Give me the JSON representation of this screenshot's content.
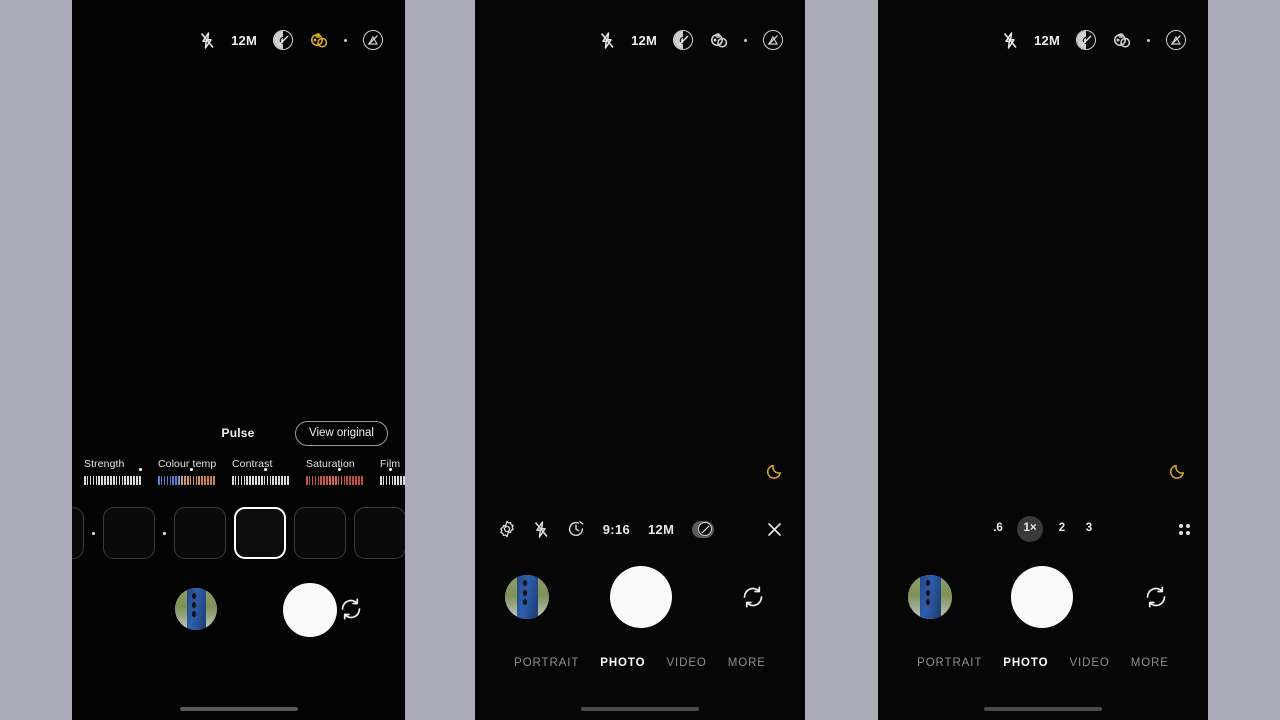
{
  "background_color": "#ACACB8",
  "panels": [
    {
      "id": "edit-panel",
      "name": "photo-filter-editor",
      "topbar": {
        "flash_icon": "flash-off-icon",
        "resolution": "12M",
        "motion_photo_icon": "motion-photo-off-icon",
        "ai_icon": "ai-scene-optimizer-icon",
        "separator": "dot-separator",
        "effects_icon": "camera-effects-icon"
      },
      "filter_name": "Pulse",
      "view_original_label": "View original",
      "adjustments": [
        {
          "label": "Strength",
          "style": "plain",
          "marker_pct": 88
        },
        {
          "label": "Colour temp",
          "style": "temp",
          "marker_pct": 50
        },
        {
          "label": "Contrast",
          "style": "plain",
          "marker_pct": 50
        },
        {
          "label": "Saturation",
          "style": "sat",
          "marker_pct": 50
        },
        {
          "label": "Film",
          "style": "plain",
          "marker_pct": 50
        }
      ],
      "filter_thumbnails": [
        {
          "name": "filter-thumb-partial",
          "selected": false
        },
        {
          "name": "filter-thumb-1",
          "selected": false
        },
        {
          "name": "filter-thumb-2",
          "selected": false
        },
        {
          "name": "filter-thumb-pulse",
          "selected": true
        },
        {
          "name": "filter-thumb-4",
          "selected": false
        },
        {
          "name": "filter-thumb-5",
          "selected": false
        },
        {
          "name": "filter-thumb-6",
          "selected": false
        }
      ],
      "gallery_thumb": "gallery-thumbnail",
      "shutter": "shutter-button",
      "flip": "flip-camera-button"
    },
    {
      "id": "middle-panel",
      "name": "camera-photo-mode",
      "topbar": {
        "flash_icon": "flash-off-icon",
        "resolution": "12M",
        "motion_photo_icon": "motion-photo-off-icon",
        "ai_icon": "ai-scene-optimizer-icon",
        "separator": "dot-separator",
        "effects_icon": "camera-effects-icon"
      },
      "night_badge": "night-mode-moon-icon",
      "controls": [
        {
          "name": "settings-button",
          "type": "icon",
          "icon": "gear-icon"
        },
        {
          "name": "flash-button",
          "type": "icon",
          "icon": "flash-off-icon"
        },
        {
          "name": "timer-button",
          "type": "icon",
          "icon": "timer-icon"
        },
        {
          "name": "aspect-ratio-button",
          "type": "text",
          "label": "9:16"
        },
        {
          "name": "resolution-button",
          "type": "text",
          "label": "12M"
        },
        {
          "name": "motion-photo-toggle",
          "type": "icon",
          "icon": "motion-photo-off-icon"
        },
        {
          "name": "night-mode-button",
          "type": "icon",
          "icon": "moon-icon"
        },
        {
          "name": "close-button",
          "type": "icon",
          "icon": "close-icon"
        }
      ],
      "modes": [
        {
          "label": "PORTRAIT",
          "active": false
        },
        {
          "label": "PHOTO",
          "active": true
        },
        {
          "label": "VIDEO",
          "active": false
        },
        {
          "label": "MORE",
          "active": false
        }
      ],
      "gallery_thumb": "gallery-thumbnail",
      "shutter": "shutter-button",
      "flip": "flip-camera-button"
    },
    {
      "id": "right-panel",
      "name": "camera-photo-mode-zoom",
      "topbar": {
        "flash_icon": "flash-off-icon",
        "resolution": "12M",
        "motion_photo_icon": "motion-photo-off-icon",
        "ai_icon": "ai-scene-optimizer-icon",
        "separator": "dot-separator",
        "effects_icon": "camera-effects-icon"
      },
      "night_badge": "night-mode-moon-icon",
      "zoom_levels": [
        {
          "label": ".6",
          "active": false
        },
        {
          "label": "1×",
          "active": true
        },
        {
          "label": "2",
          "active": false
        },
        {
          "label": "3",
          "active": false
        }
      ],
      "more_zoom_icon": "grid-dots-icon",
      "modes": [
        {
          "label": "PORTRAIT",
          "active": false
        },
        {
          "label": "PHOTO",
          "active": true
        },
        {
          "label": "VIDEO",
          "active": false
        },
        {
          "label": "MORE",
          "active": false
        }
      ],
      "gallery_thumb": "gallery-thumbnail",
      "shutter": "shutter-button",
      "flip": "flip-camera-button"
    }
  ],
  "colors": {
    "accent_gold": "#D8A72A",
    "shutter": "#FAFAFA",
    "panel_bg": "#000000",
    "zoom_active_bg": "#3A3A3A"
  }
}
